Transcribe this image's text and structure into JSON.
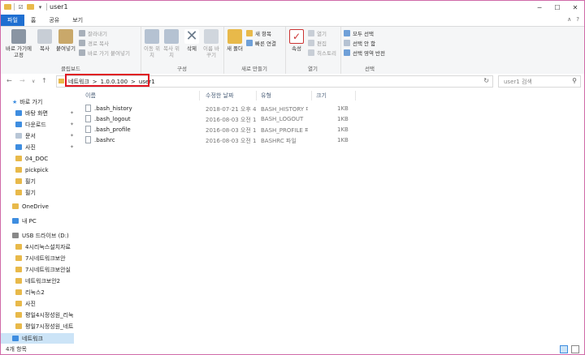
{
  "window": {
    "title": "user1"
  },
  "qat": {
    "dropdown": "▾"
  },
  "tabs": [
    "파일",
    "홈",
    "공유",
    "보기"
  ],
  "ribbon": {
    "clipboard": {
      "label": "클립보드",
      "pin": "바로 가기에 고정",
      "copy": "복사",
      "paste": "붙여넣기",
      "cut": "잘라내기",
      "copy_path": "경로 복사",
      "paste_shortcut": "바로 가기 붙여넣기"
    },
    "organize": {
      "label": "구성",
      "move_to": "이동 위치",
      "copy_to": "복사 위치",
      "delete": "삭제",
      "rename": "이름 바꾸기"
    },
    "new": {
      "label": "새로 만들기",
      "new_folder": "새 폴더",
      "new_item": "새 항목",
      "easy_access": "빠른 연결"
    },
    "open": {
      "label": "열기",
      "properties": "속성",
      "open": "열기",
      "edit": "편집",
      "history": "히스토리"
    },
    "select": {
      "label": "선택",
      "select_all": "모두 선택",
      "select_none": "선택 안 함",
      "invert": "선택 영역 반전"
    }
  },
  "address": {
    "crumbs": [
      "네트워크",
      "1.0.0.100",
      "user1"
    ],
    "separator": ">",
    "search_placeholder": "user1 검색"
  },
  "nav": [
    {
      "label": "바로 가기",
      "icon": "star-icon"
    },
    {
      "label": "바탕 화면",
      "icon": "folder-blue-icon",
      "pinned": true
    },
    {
      "label": "다운로드",
      "icon": "download-icon",
      "pinned": true
    },
    {
      "label": "문서",
      "icon": "document-icon",
      "pinned": true
    },
    {
      "label": "사진",
      "icon": "pictures-icon",
      "pinned": true
    },
    {
      "label": "04_DOC",
      "icon": "folder-icon"
    },
    {
      "label": "pickpick",
      "icon": "folder-icon"
    },
    {
      "label": "필기",
      "icon": "folder-icon"
    },
    {
      "label": "필기",
      "icon": "folder-icon"
    },
    {
      "label": "OneDrive",
      "icon": "onedrive-icon"
    },
    {
      "label": "내 PC",
      "icon": "pc-icon"
    },
    {
      "label": "USB 드라이브 (D:)",
      "icon": "usb-icon"
    },
    {
      "label": "4시리눅스설치자료",
      "icon": "folder-icon"
    },
    {
      "label": "7시네트워크보안",
      "icon": "folder-icon"
    },
    {
      "label": "7시네트워크보안실",
      "icon": "folder-icon"
    },
    {
      "label": "네트워크보안2",
      "icon": "folder-icon"
    },
    {
      "label": "리눅스2",
      "icon": "folder-icon"
    },
    {
      "label": "사진",
      "icon": "folder-icon"
    },
    {
      "label": "평일4시정성원_리눅",
      "icon": "folder-icon"
    },
    {
      "label": "평일7시정성원_네트",
      "icon": "folder-icon"
    },
    {
      "label": "네트워크",
      "icon": "network-icon",
      "selected": true
    }
  ],
  "columns": [
    "이름",
    "수정한 날짜",
    "유형",
    "크기"
  ],
  "files": [
    {
      "name": ".bash_history",
      "date": "2018-07-21 오후 4",
      "type": "BASH_HISTORY 파",
      "size": "1KB"
    },
    {
      "name": ".bash_logout",
      "date": "2016-08-03 오전 1",
      "type": "BASH_LOGOUT",
      "size": "1KB"
    },
    {
      "name": ".bash_profile",
      "date": "2016-08-03 오전 1",
      "type": "BASH_PROFILE 파",
      "size": "1KB"
    },
    {
      "name": ".bashrc",
      "date": "2016-08-03 오전 1",
      "type": "BASHRC 파일",
      "size": "1KB"
    }
  ],
  "status": {
    "count": "4개 항목"
  }
}
